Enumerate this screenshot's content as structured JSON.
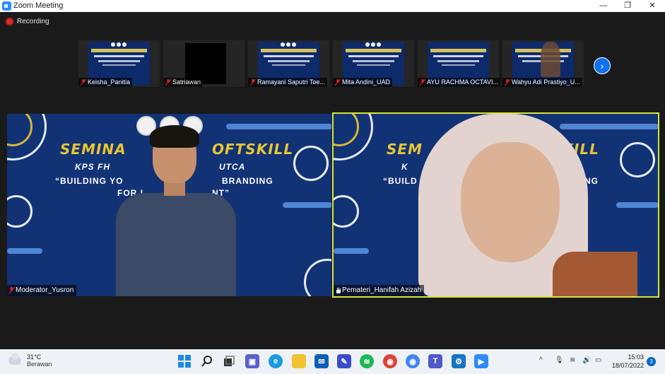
{
  "window": {
    "title": "Zoom Meeting",
    "minimize": "—",
    "restore": "❐",
    "close": "✕"
  },
  "recording": {
    "label": "Recording"
  },
  "thumbnails": [
    {
      "name": "Keisha_Panitia",
      "mic": "muted",
      "view": "slide"
    },
    {
      "name": "Satriawan",
      "mic": "muted",
      "view": "black"
    },
    {
      "name": "Ramayani Saputri Toe...",
      "mic": "muted",
      "view": "slide"
    },
    {
      "name": "Mita Andini_UAD",
      "mic": "muted",
      "view": "slide"
    },
    {
      "name": "AYU RACHMA OCTAVI...",
      "mic": "muted",
      "view": "slide"
    },
    {
      "name": "Wahyu Adi Prastiyo_U...",
      "mic": "muted",
      "view": "slide-person"
    }
  ],
  "main_tiles": [
    {
      "name": "Moderator_Yusron",
      "slide_head": "SEMINA",
      "slide_head2": "OFTSKILL",
      "slide_sub": "“BUILDING YO",
      "slide_sub_b": "BRANDING",
      "slide_sub2": "FOR L",
      "slide_sub2_b": "NT”",
      "slide_ribbon": "KPS FH",
      "slide_ribbon2": "UTCA"
    },
    {
      "name": "Pemateri_Hanifah Azizah",
      "slide_head": "SEM",
      "slide_head2": "SKILL",
      "slide_sub": "“BUILD",
      "slide_sub_b": "RANDING",
      "slide_ribbon": "K"
    }
  ],
  "taskbar": {
    "weather_temp": "31°C",
    "weather_desc": "Berawan",
    "time": "15:03",
    "date": "18/07/2022",
    "notification_count": "3",
    "tray_chevron": "^"
  },
  "colors": {
    "accent": "#0e72ed",
    "active_speaker": "#d6e636",
    "recording": "#e02828",
    "slide_bg": "#123276",
    "slide_title": "#e7c632"
  }
}
